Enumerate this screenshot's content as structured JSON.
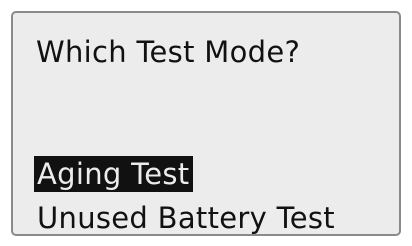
{
  "screen": {
    "prompt": "Which Test Mode?",
    "options": [
      {
        "label": "Aging Test",
        "selected": true
      },
      {
        "label": "Unused Battery Test",
        "selected": false
      }
    ]
  },
  "colors": {
    "screen_bg": "#ececec",
    "text": "#111111",
    "highlight_bg": "#111111",
    "highlight_text": "#ececec",
    "border": "#8a8a8a"
  }
}
